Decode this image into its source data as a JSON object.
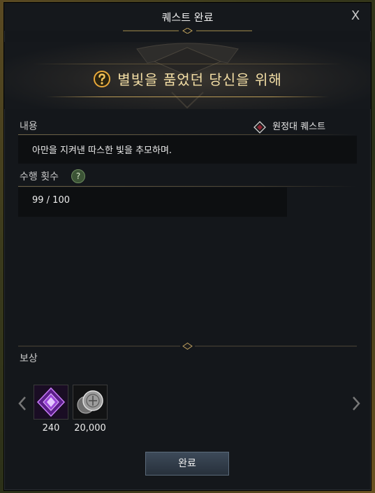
{
  "window": {
    "title": "퀘스트 완료",
    "close_label": "X"
  },
  "quest": {
    "name": "별빛을 품었던 당신을 위해",
    "icon": "question-quest-icon"
  },
  "content": {
    "label": "내용",
    "type_label": "원정대 퀘스트",
    "type_icon": "expedition-diamond-icon",
    "description": "아만을 지켜낸 따스한 빛을 추모하며."
  },
  "progress": {
    "label": "수행 횟수",
    "help_icon": "?",
    "value": "99 / 100"
  },
  "rewards": {
    "label": "보상",
    "items": [
      {
        "icon": "purple-crystal-icon",
        "count": "240"
      },
      {
        "icon": "silver-coin-icon",
        "count": "20,000"
      }
    ]
  },
  "actions": {
    "complete_label": "완료"
  },
  "colors": {
    "accent_gold": "#f4dfa6",
    "panel_bg": "#14171b",
    "button_bg": "#2f3945"
  }
}
